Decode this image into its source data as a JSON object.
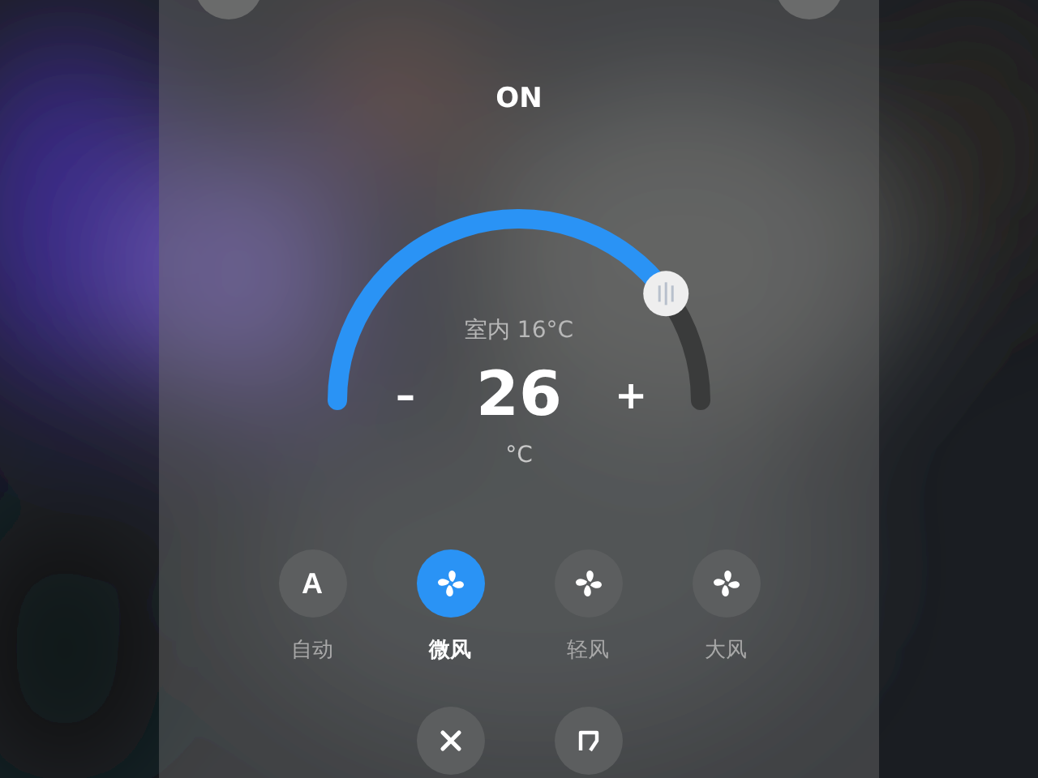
{
  "power_status": "ON",
  "thermostat": {
    "indoor": "室内 16°C",
    "minus": "–",
    "value": "26",
    "plus": "+",
    "unit": "°C"
  },
  "fan_modes": [
    {
      "kind": "letter",
      "icon_text": "A",
      "label": "自动",
      "selected": false
    },
    {
      "kind": "fan",
      "label": "微风",
      "selected": true
    },
    {
      "kind": "fan",
      "label": "轻风",
      "selected": false
    },
    {
      "kind": "fan",
      "label": "大风",
      "selected": false
    }
  ],
  "bottom_buttons": [
    {
      "kind": "close"
    },
    {
      "kind": "frame"
    }
  ]
}
